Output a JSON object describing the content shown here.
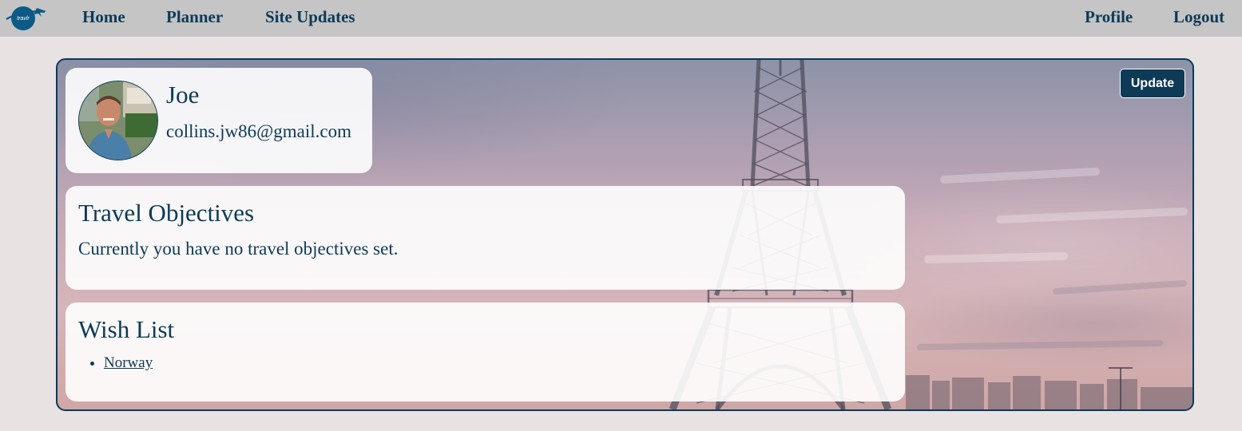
{
  "nav": {
    "logo_text": "travlr",
    "links": [
      "Home",
      "Planner",
      "Site Updates"
    ],
    "right_links": [
      "Profile",
      "Logout"
    ]
  },
  "profile": {
    "update_label": "Update",
    "name": "Joe",
    "email": "collins.jw86@gmail.com"
  },
  "objectives": {
    "title": "Travel Objectives",
    "text": "Currently you have no travel objectives set."
  },
  "wishlist": {
    "title": "Wish List",
    "items": [
      "Norway"
    ]
  },
  "colors": {
    "primary": "#0c3a57",
    "navbar_bg": "#c5c5c5",
    "page_bg": "#e8e2e2"
  },
  "icons": {
    "logo": "travlr-plane-logo-icon",
    "avatar": "user-avatar-photo"
  }
}
